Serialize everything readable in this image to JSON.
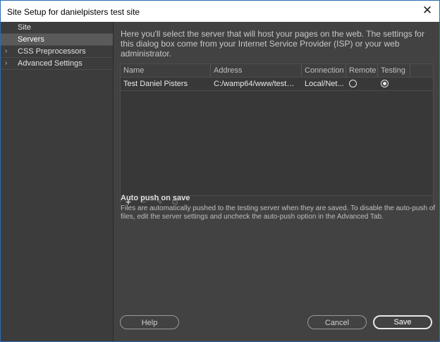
{
  "window": {
    "title": "Site Setup for danielpisters test site",
    "close_icon": "close-icon"
  },
  "sidebar": {
    "items": [
      {
        "label": "Site",
        "expandable": false,
        "selected": false
      },
      {
        "label": "Servers",
        "expandable": false,
        "selected": true
      },
      {
        "label": "CSS Preprocessors",
        "expandable": true,
        "selected": false
      },
      {
        "label": "Advanced Settings",
        "expandable": true,
        "selected": false
      }
    ]
  },
  "main": {
    "intro": "Here you'll select the server that will host your pages on the web. The settings for this dialog box come from your Internet Service Provider (ISP) or your web administrator.",
    "table": {
      "columns": [
        "Name",
        "Address",
        "Connection",
        "Remote",
        "Testing"
      ],
      "rows": [
        {
          "name": "Test Daniel Pisters",
          "address": "C:/wamp64/www/testda...",
          "connection": "Local/Net...",
          "remote": false,
          "testing": true
        }
      ]
    },
    "toolbar": {
      "add": "+",
      "remove": "−",
      "edit": "✎",
      "duplicate": "⧉"
    },
    "auto_push": {
      "title": "Auto push on save",
      "body": "Files are automatically pushed to the testing server when they are saved. To disable the auto-push of files, edit the server settings and uncheck the auto-push option in the Advanced Tab."
    }
  },
  "buttons": {
    "help": "Help",
    "cancel": "Cancel",
    "save": "Save"
  },
  "colors": {
    "accent_border": "#2b6cb0",
    "panel": "#424242",
    "sidebar_selected": "#5a5a5a"
  }
}
